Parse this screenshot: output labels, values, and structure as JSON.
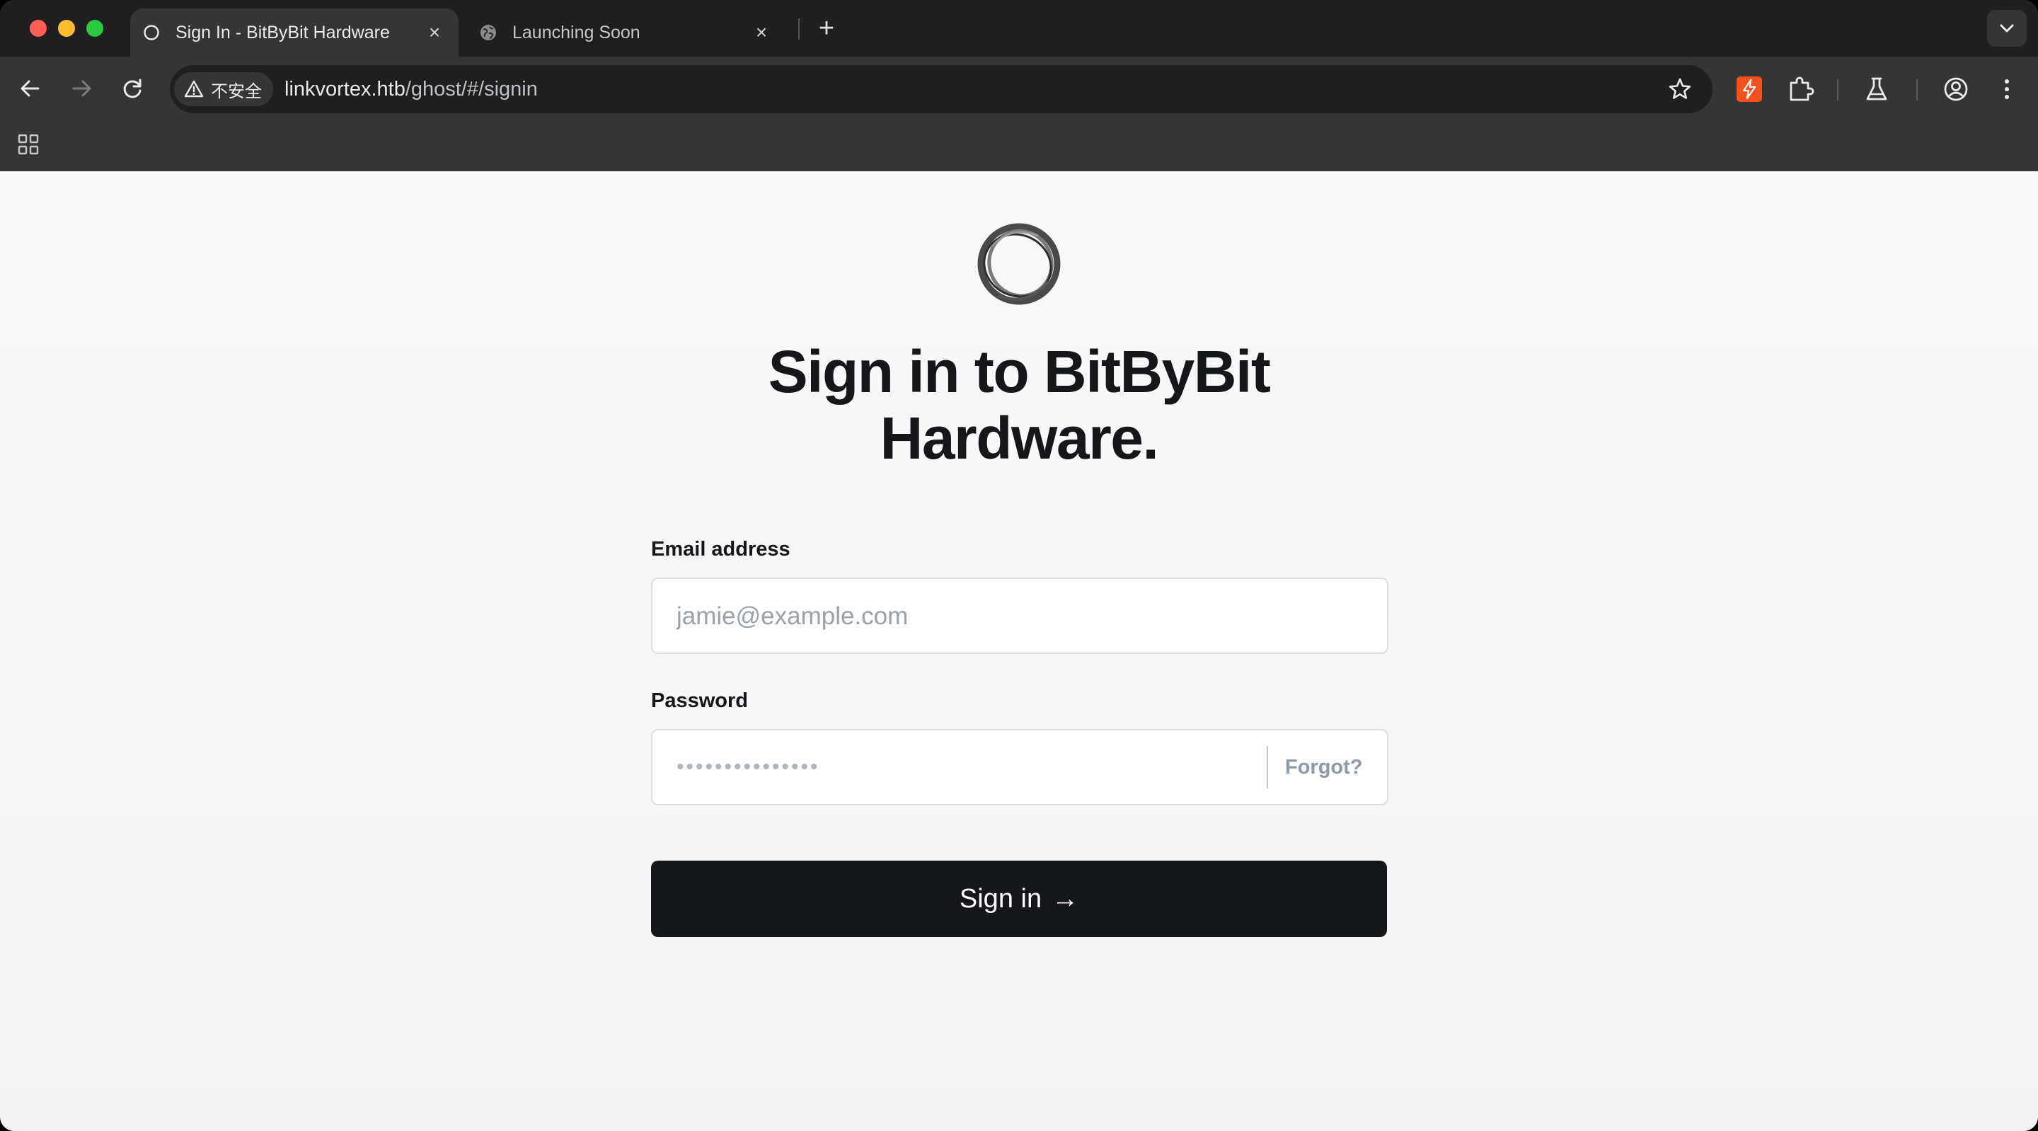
{
  "browser": {
    "tabs": [
      {
        "title": "Sign In - BitByBit Hardware",
        "active": true,
        "close": "×"
      },
      {
        "title": "Launching Soon",
        "active": false,
        "close": "×"
      }
    ],
    "new_tab": "+",
    "security_label": "不安全",
    "url": {
      "host": "linkvortex.htb",
      "path": "/ghost/#/signin"
    },
    "icons": [
      "back-icon",
      "forward-icon",
      "reload-icon",
      "warning-icon",
      "star-icon",
      "extension-icon",
      "puzzle-icon",
      "labs-flask-icon",
      "profile-icon",
      "more-icon",
      "apps-grid-icon"
    ]
  },
  "page": {
    "heading_line1": "Sign in to BitByBit",
    "heading_line2": "Hardware.",
    "email": {
      "label": "Email address",
      "placeholder": "jamie@example.com",
      "value": ""
    },
    "password": {
      "label": "Password",
      "masked_value": "•••••••••••••••",
      "forgot_label": "Forgot?"
    },
    "submit_label": "Sign in",
    "submit_arrow": "→"
  },
  "colors": {
    "accent_button": "#15171a",
    "page_background": "#f6f6f6",
    "chrome_dark": "#1f1f1f",
    "extension_badge": "#f4511e"
  }
}
